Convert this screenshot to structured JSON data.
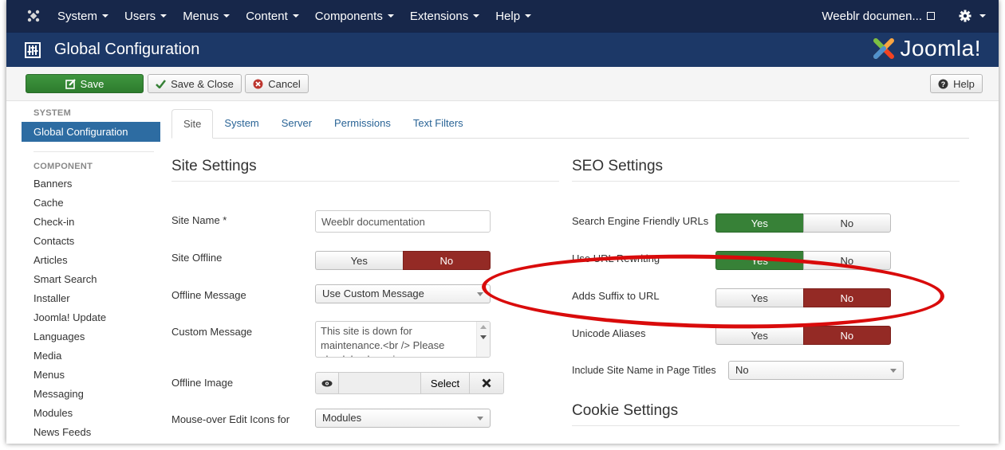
{
  "topnav": {
    "menu": [
      {
        "label": "System"
      },
      {
        "label": "Users"
      },
      {
        "label": "Menus"
      },
      {
        "label": "Content"
      },
      {
        "label": "Components"
      },
      {
        "label": "Extensions"
      },
      {
        "label": "Help"
      }
    ],
    "site_link": "Weeblr documen...",
    "icons": {
      "logo": "joomla-logo-icon",
      "external": "external-link-icon",
      "settings": "gear-icon"
    }
  },
  "header": {
    "title": "Global Configuration",
    "brand": "Joomla!"
  },
  "toolbar": {
    "save_label": "Save",
    "save_close_label": "Save & Close",
    "cancel_label": "Cancel",
    "help_label": "Help"
  },
  "sidebar": {
    "system_header": "SYSTEM",
    "active_item": "Global Configuration",
    "component_header": "COMPONENT",
    "items": [
      {
        "label": "Banners"
      },
      {
        "label": "Cache"
      },
      {
        "label": "Check-in"
      },
      {
        "label": "Contacts"
      },
      {
        "label": "Articles"
      },
      {
        "label": "Smart Search"
      },
      {
        "label": "Installer"
      },
      {
        "label": "Joomla! Update"
      },
      {
        "label": "Languages"
      },
      {
        "label": "Media"
      },
      {
        "label": "Menus"
      },
      {
        "label": "Messaging"
      },
      {
        "label": "Modules"
      },
      {
        "label": "News Feeds"
      }
    ]
  },
  "tabs": [
    {
      "label": "Site",
      "active": true
    },
    {
      "label": "System"
    },
    {
      "label": "Server"
    },
    {
      "label": "Permissions"
    },
    {
      "label": "Text Filters"
    }
  ],
  "site_settings": {
    "title": "Site Settings",
    "site_name_label": "Site Name *",
    "site_name_value": "Weeblr documentation",
    "site_offline_label": "Site Offline",
    "site_offline": {
      "yes": "Yes",
      "no": "No",
      "selected": "No"
    },
    "offline_message_label": "Offline Message",
    "offline_message_value": "Use Custom Message",
    "custom_message_label": "Custom Message",
    "custom_message_value": "This site is down for maintenance.<br /> Please check back again soon.",
    "offline_image_label": "Offline Image",
    "offline_image_select": "Select",
    "mouseover_label": "Mouse-over Edit Icons for",
    "mouseover_value": "Modules"
  },
  "seo_settings": {
    "title": "SEO Settings",
    "sef_label": "Search Engine Friendly URLs",
    "sef": {
      "yes": "Yes",
      "no": "No",
      "selected": "Yes"
    },
    "rewrite_label": "Use URL Rewriting",
    "rewrite": {
      "yes": "Yes",
      "no": "No",
      "selected": "Yes"
    },
    "suffix_label": "Adds Suffix to URL",
    "suffix": {
      "yes": "Yes",
      "no": "No",
      "selected": "No"
    },
    "unicode_label": "Unicode Aliases",
    "unicode": {
      "yes": "Yes",
      "no": "No",
      "selected": "No"
    },
    "sitename_label": "Include Site Name in Page Titles",
    "sitename_value": "No"
  },
  "cookie_settings": {
    "title": "Cookie Settings"
  },
  "annotation": {
    "color": "#d90b0b",
    "target": "Adds Suffix to URL"
  },
  "colors": {
    "topnav": "#17274a",
    "header": "#1c3867",
    "save": "#378137",
    "no_active": "#942a25",
    "sidebar_active": "#2d6ca2"
  }
}
